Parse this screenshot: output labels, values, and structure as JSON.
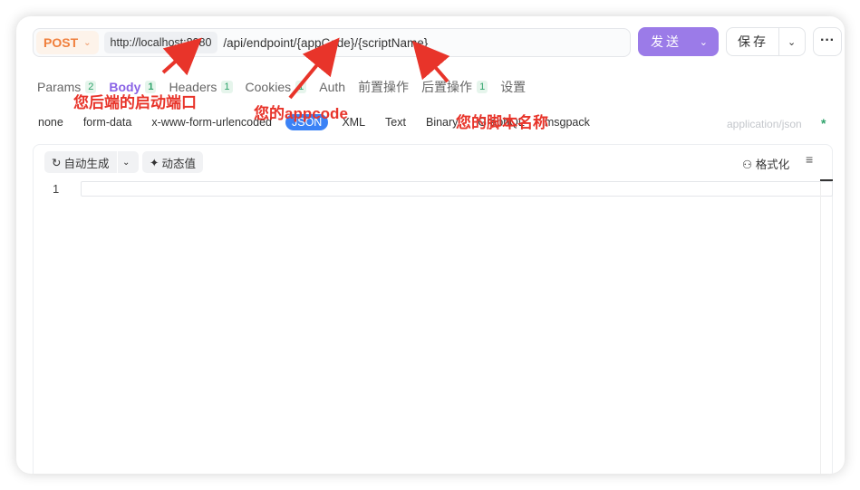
{
  "request": {
    "method": "POST",
    "host": "http://localhost:8080",
    "path": "/api/endpoint/{appCode}/{scriptName}",
    "send_label": "发送",
    "save_label": "保存",
    "more_label": "···"
  },
  "tabs": [
    {
      "label": "Params",
      "badge": "2"
    },
    {
      "label": "Body",
      "badge": "1"
    },
    {
      "label": "Headers",
      "badge": "1"
    },
    {
      "label": "Cookies",
      "badge": "1"
    },
    {
      "label": "Auth",
      "badge": ""
    },
    {
      "label": "前置操作",
      "badge": ""
    },
    {
      "label": "后置操作",
      "badge": "1"
    },
    {
      "label": "设置",
      "badge": ""
    }
  ],
  "body_types": [
    "none",
    "form-data",
    "x-www-form-urlencoded",
    "JSON",
    "XML",
    "Text",
    "Binary",
    "GraphQL",
    "msgpack"
  ],
  "content_type": "application/json",
  "content_type_marker": "*",
  "editor": {
    "autogen_label": "自动生成",
    "dynamic_label": "动态值",
    "format_label": "格式化",
    "line_number": "1",
    "resize_handle": "..."
  },
  "annotations": {
    "port": "您后端的启动端口",
    "appcode": "您的appcode",
    "script": "您的脚本名称"
  },
  "colors": {
    "accent": "#9b7be8",
    "method": "#f07f3c",
    "json_pill": "#3b82f6",
    "annotation": "#e8342a"
  }
}
